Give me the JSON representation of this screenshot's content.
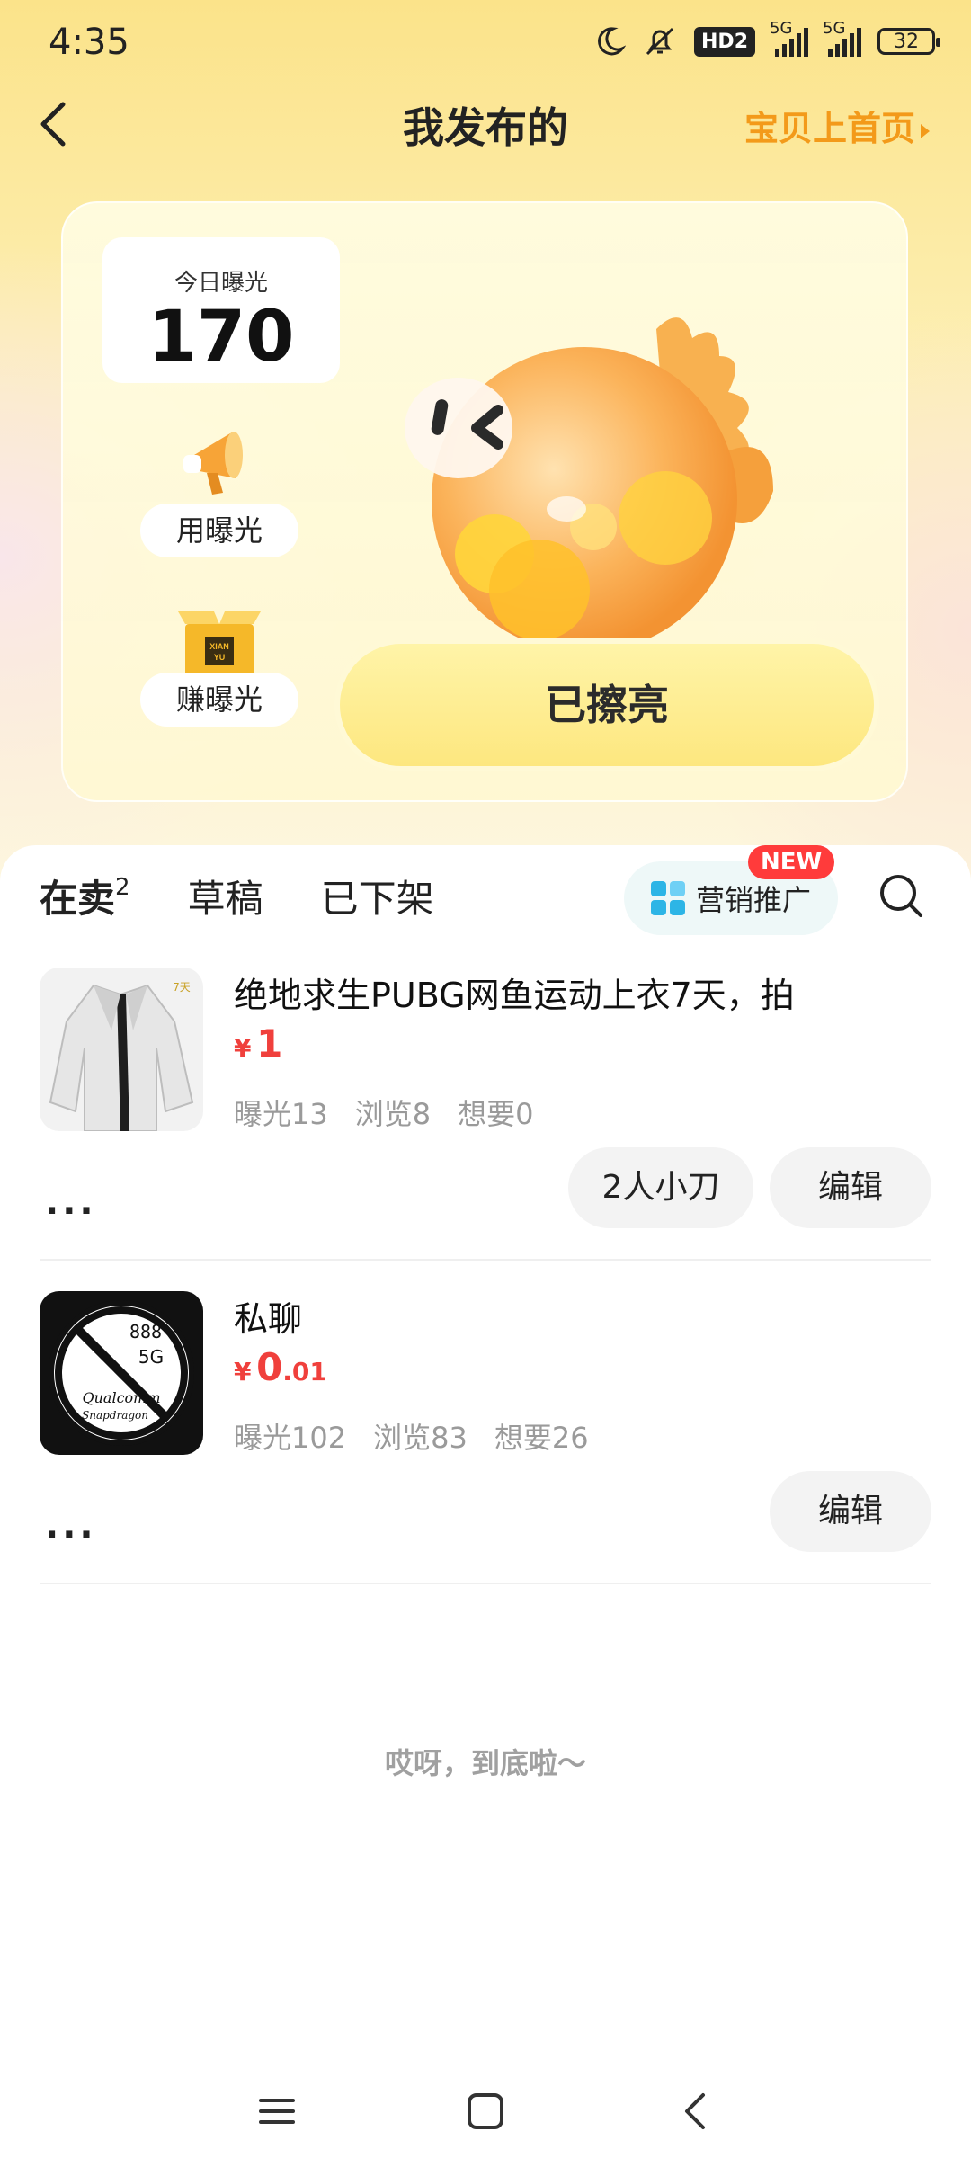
{
  "status": {
    "time": "4:35",
    "hd": "HD2",
    "net1": "5G",
    "net2": "5G",
    "battery": "32"
  },
  "header": {
    "title": "我发布的",
    "promote": "宝贝上首页"
  },
  "exposure": {
    "today_label": "今日曝光",
    "today_value": "170",
    "use_label": "用曝光",
    "earn_label": "赚曝光",
    "polish_label": "已擦亮",
    "box_text": "XIAN YU"
  },
  "tabs": {
    "selling": "在卖",
    "selling_count": "2",
    "drafts": "草稿",
    "removed": "已下架",
    "marketing": "营销推广",
    "new_badge": "NEW"
  },
  "items": [
    {
      "title": "绝地求生PUBG网鱼运动上衣7天，拍",
      "yen": "¥",
      "price_int": "1",
      "price_dec": "",
      "views": "曝光13",
      "browse": "浏览8",
      "wants": "想要0",
      "offer": "2人小刀",
      "edit": "编辑",
      "more": "···",
      "thumb_tag": "7天"
    },
    {
      "title": "私聊",
      "yen": "¥",
      "price_int": "0",
      "price_dec": ".01",
      "views": "曝光102",
      "browse": "浏览83",
      "wants": "想要26",
      "edit": "编辑",
      "more": "···",
      "thumb_text": [
        "888",
        "5G",
        "Qualcomm",
        "Snapdragon"
      ]
    }
  ],
  "footer": {
    "end_text": "哎呀，到底啦～"
  },
  "colors": {
    "accent": "#f39a1a",
    "price": "#f0403c",
    "highlight": "#ffe033"
  }
}
